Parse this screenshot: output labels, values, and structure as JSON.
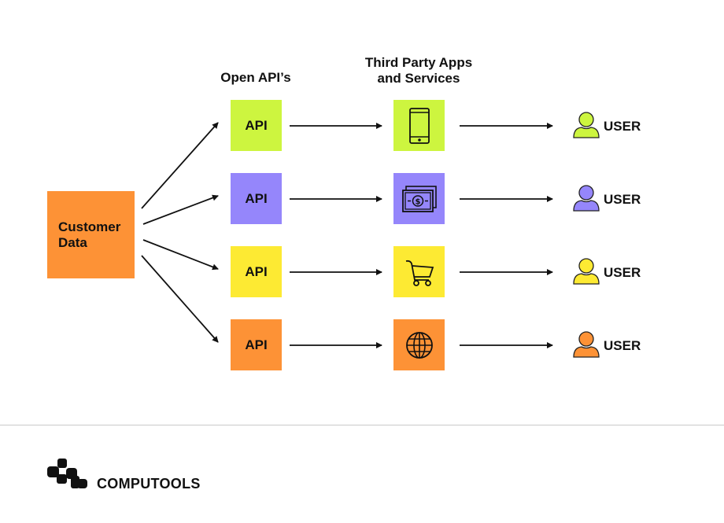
{
  "headings": {
    "open_apis": "Open API’s",
    "third_party_line1": "Third Party Apps",
    "third_party_line2": "and Services"
  },
  "source": {
    "line1": "Customer",
    "line2": "Data",
    "color": "#FD9236"
  },
  "rows": [
    {
      "api_label": "API",
      "color": "#CDF53F",
      "service_icon": "smartphone-icon",
      "user_label": "USER",
      "user_color": "#CDF53F"
    },
    {
      "api_label": "API",
      "color": "#9586FB",
      "service_icon": "money-icon",
      "user_label": "USER",
      "user_color": "#9586FB"
    },
    {
      "api_label": "API",
      "color": "#FDEA33",
      "service_icon": "shopping-cart-icon",
      "user_label": "USER",
      "user_color": "#FDEA33"
    },
    {
      "api_label": "API",
      "color": "#FD9236",
      "service_icon": "globe-icon",
      "user_label": "USER",
      "user_color": "#FD9236"
    }
  ],
  "footer": {
    "brand": "COMPUTOOLS"
  }
}
